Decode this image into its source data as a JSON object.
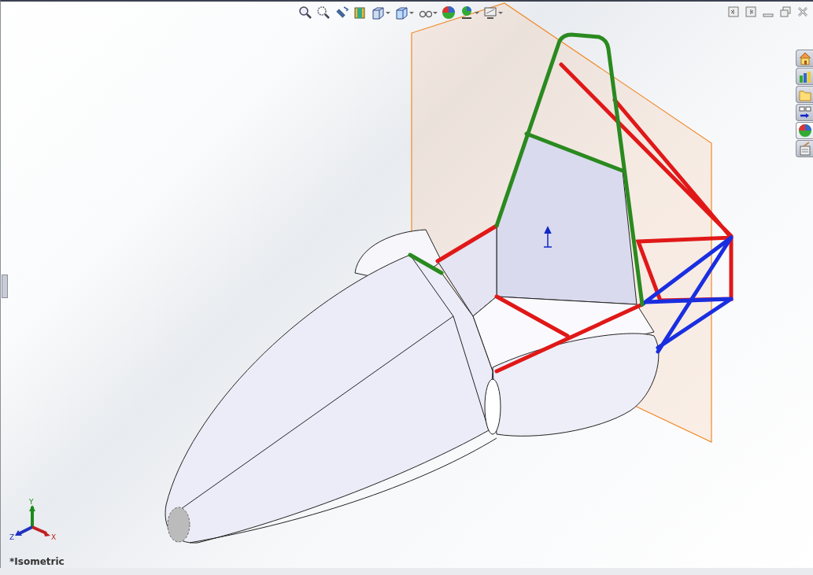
{
  "toolbar": [
    {
      "kind": "zoom-fit",
      "menu": false
    },
    {
      "kind": "zoom-area",
      "menu": false
    },
    {
      "kind": "previous-view",
      "menu": false
    },
    {
      "kind": "section-view",
      "menu": false
    },
    {
      "kind": "view-orientation",
      "menu": true
    },
    {
      "kind": "display-style",
      "menu": true
    },
    {
      "kind": "hide-show",
      "menu": true
    },
    {
      "kind": "appearance",
      "menu": false
    },
    {
      "kind": "scene",
      "menu": true
    },
    {
      "kind": "view-settings",
      "menu": true
    }
  ],
  "task_pane": [
    {
      "kind": "home",
      "selected": false
    },
    {
      "kind": "library",
      "selected": false
    },
    {
      "kind": "folder",
      "selected": false
    },
    {
      "kind": "palette",
      "selected": false
    },
    {
      "kind": "appearances",
      "selected": true
    },
    {
      "kind": "properties",
      "selected": false
    }
  ],
  "triad": {
    "y": "Y",
    "z": "Z",
    "x": "X"
  },
  "view_label": "*Isometric"
}
